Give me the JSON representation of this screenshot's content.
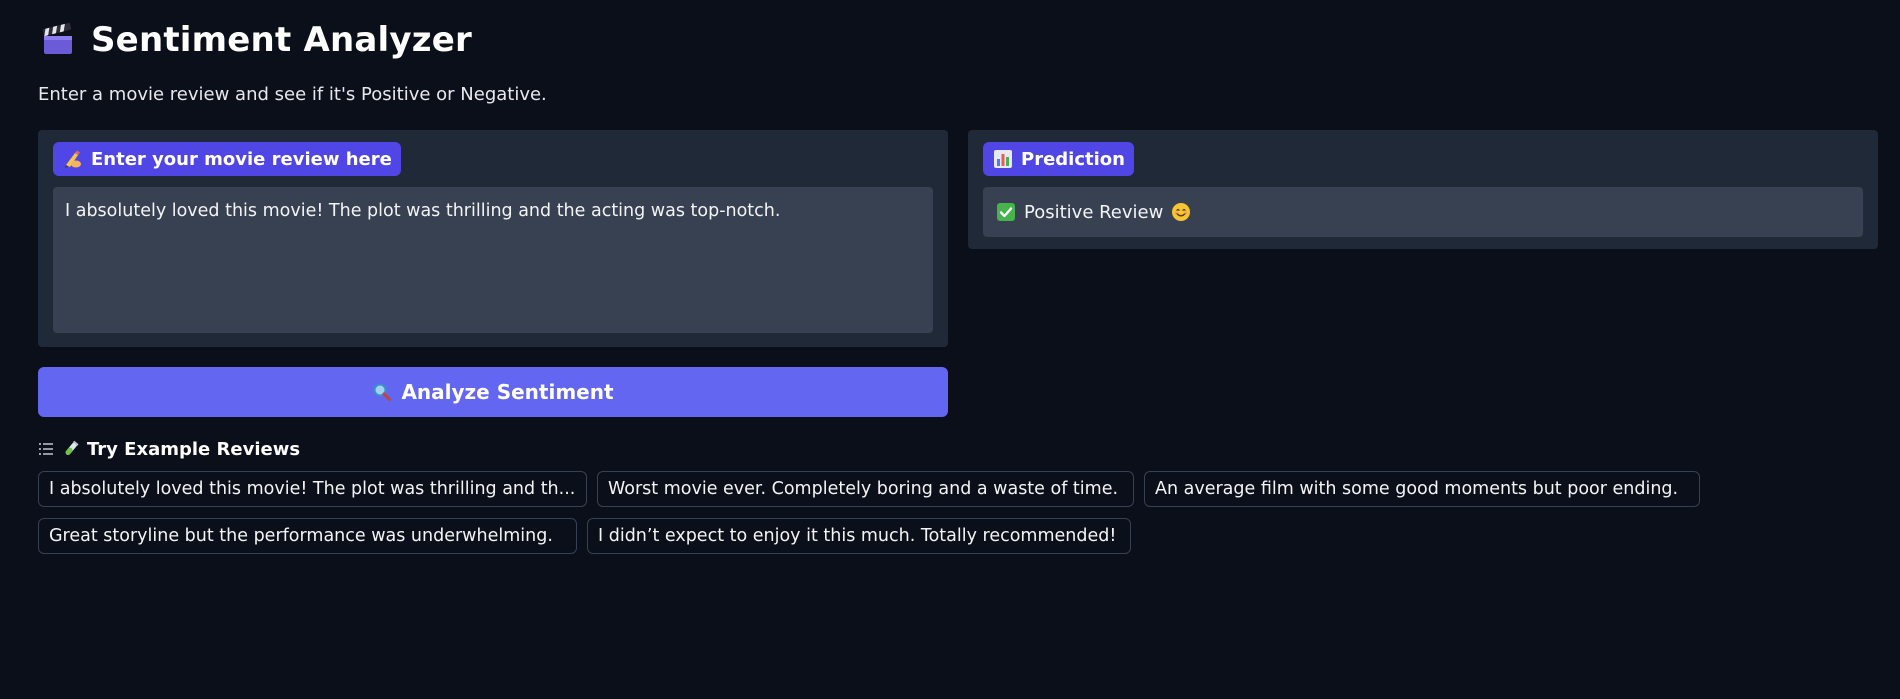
{
  "header": {
    "title": "Sentiment Analyzer",
    "title_icon": "clapperboard-icon",
    "subtitle": "Enter a movie review and see if it's Positive or Negative."
  },
  "input": {
    "label": "Enter your movie review here",
    "label_icon": "writing-hand-icon",
    "value": "I absolutely loved this movie! The plot was thrilling and the acting was top-notch."
  },
  "output": {
    "label": "Prediction",
    "label_icon": "bar-chart-icon",
    "value": "Positive Review",
    "value_icon": "check-mark-icon",
    "trailing_icon": "smiling-face-icon"
  },
  "actions": {
    "analyze_label": "Analyze Sentiment",
    "analyze_icon": "magnifying-glass-icon"
  },
  "examples": {
    "label": "Try Example Reviews",
    "icons": [
      "list-icon",
      "test-tube-icon"
    ],
    "items": [
      "I absolutely loved this movie! The plot was thrilling and th...",
      "Worst movie ever. Completely boring and a waste of time.",
      "An average film with some good moments but poor ending.",
      "Great storyline but the performance was underwhelming.",
      "I didn’t expect to enjoy it this much. Totally recommended!"
    ]
  },
  "colors": {
    "background": "#0b0f19",
    "panel": "#1f2937",
    "field": "#374151",
    "accent": "#4f46e5",
    "button": "#6366f1"
  }
}
